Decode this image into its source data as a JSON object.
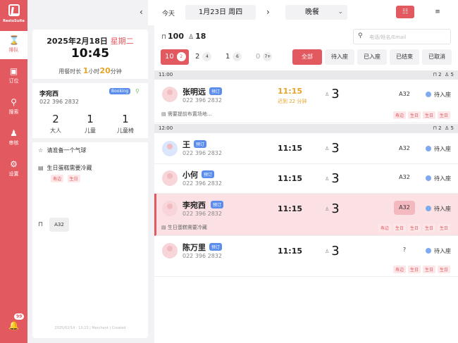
{
  "app": {
    "logo_text": "RestoSuite"
  },
  "rail": {
    "items": [
      {
        "icon": "hourglass-icon",
        "label": "排队",
        "active": true
      },
      {
        "icon": "calendar-icon",
        "label": "订位",
        "active": false
      },
      {
        "icon": "search-icon",
        "label": "搜索",
        "active": false
      },
      {
        "icon": "user-icon",
        "label": "审核",
        "active": false
      },
      {
        "icon": "gear-icon",
        "label": "设置",
        "active": false
      }
    ],
    "notifications": "99"
  },
  "left": {
    "date": "2025年2月18日",
    "weekday": "星期二",
    "time": "10:45",
    "duration_prefix": "用餐时长",
    "duration_h": "1",
    "duration_h_unit": "小时",
    "duration_m": "20",
    "duration_m_unit": "分钟",
    "guest_name": "李宛西",
    "guest_tag": "Booking",
    "guest_phone": "022 396 2832",
    "counts": [
      {
        "value": "2",
        "label": "大人"
      },
      {
        "value": "1",
        "label": "儿童"
      },
      {
        "value": "1",
        "label": "儿童椅"
      }
    ],
    "note1": "请准备一个气球",
    "note2": "生日蛋糕需要冷藏",
    "note2_tags": [
      "寿边",
      "生日"
    ],
    "table": "A32",
    "footer": "2025/02/14 · 13:23 | Merchant | Created"
  },
  "topbar": {
    "today": "今天",
    "date": "1月23日 周四",
    "meal": "晚餐"
  },
  "main": {
    "total_tables": "100",
    "total_guests": "18",
    "search_placeholder": "电话/姓名/Email",
    "party_filters": [
      {
        "label": "10",
        "count": "2"
      },
      {
        "label": "2",
        "count": "4"
      },
      {
        "label": "1",
        "count": "6"
      },
      {
        "label": "0",
        "count": "7+"
      }
    ],
    "status_filters": [
      "全部",
      "待入座",
      "已入座",
      "已结束",
      "已取消"
    ],
    "sections": [
      {
        "time": "11:00",
        "tables": "2",
        "guests": "5"
      },
      {
        "time": "12:00",
        "tables": "2",
        "guests": "5"
      }
    ],
    "reservations": [
      {
        "name": "张明远",
        "tag": "预订",
        "phone": "022 396 2832",
        "time": "11:15",
        "late": "迟到 22 分钟",
        "pax": "3",
        "table": "A32",
        "status": "待入座",
        "note": "需要提前布置场地...",
        "tags": [
          "寿边",
          "生日",
          "生日",
          "生日"
        ]
      },
      {
        "name": "王",
        "tag": "预订",
        "phone": "022 396 2832",
        "time": "11:15",
        "pax": "3",
        "table": "A32",
        "status": "待入座"
      },
      {
        "name": "小何",
        "tag": "预订",
        "phone": "022 396 2832",
        "time": "11:15",
        "pax": "3",
        "table": "A32",
        "status": "待入座"
      },
      {
        "name": "李宛西",
        "tag": "预订",
        "phone": "022 396 2832",
        "time": "11:15",
        "pax": "3",
        "table": "A32",
        "status": "待入座",
        "note": "生日蛋糕需要冷藏",
        "tags": [
          "寿边",
          "生日",
          "生日",
          "生日",
          "生日"
        ]
      },
      {
        "name": "陈万里",
        "tag": "预订",
        "phone": "022 396 2832",
        "time": "11:15",
        "pax": "3",
        "table": "?",
        "status": "待入座",
        "tags": [
          "寿边",
          "生日",
          "生日",
          "生日"
        ]
      }
    ]
  }
}
